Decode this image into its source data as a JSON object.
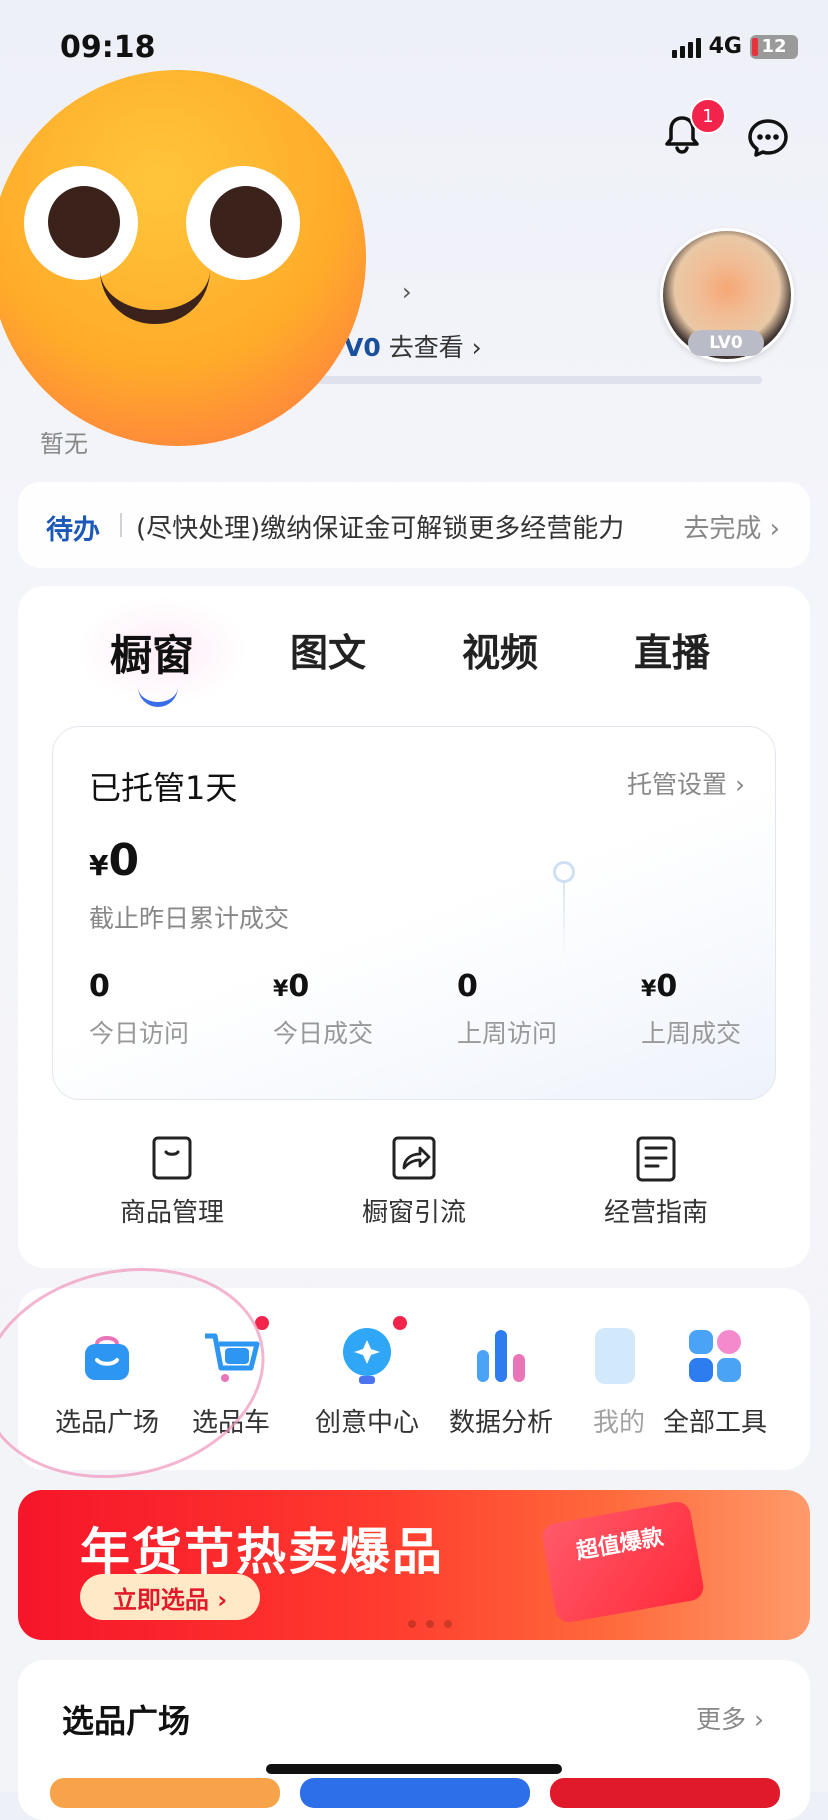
{
  "status_bar": {
    "time": "09:18",
    "network": "4G",
    "battery": "12"
  },
  "header": {
    "notification_count": "1"
  },
  "profile": {
    "level_prefix": "V0",
    "level_link": "去查看 ›",
    "avatar_level": "LV0",
    "desc_partial": "暂无"
  },
  "todo": {
    "tag": "待办",
    "text": "(尽快处理)缴纳保证金可解锁更多经营能力",
    "action": "去完成 ›"
  },
  "tabs": [
    "橱窗",
    "图文",
    "视频",
    "直播"
  ],
  "stats": {
    "title": "已托管1天",
    "settings_link": "托管设置 ›",
    "currency": "¥",
    "total_value": "0",
    "total_label": "截止昨日累计成交",
    "metrics": [
      {
        "value": "0",
        "currency": "",
        "label": "今日访问"
      },
      {
        "value": "0",
        "currency": "¥",
        "label": "今日成交"
      },
      {
        "value": "0",
        "currency": "",
        "label": "上周访问"
      },
      {
        "value": "0",
        "currency": "¥",
        "label": "上周成交"
      }
    ]
  },
  "quick_tools": [
    "商品管理",
    "橱窗引流",
    "经营指南"
  ],
  "tools": [
    "选品广场",
    "选品车",
    "创意中心",
    "数据分析",
    "我的",
    "全部工具"
  ],
  "banner": {
    "title": "年货节热卖爆品",
    "button": "立即选品 ›",
    "tag": "超值爆款"
  },
  "section": {
    "title": "选品广场",
    "more": "更多 ›"
  },
  "colors": {
    "accent_blue": "#1c58b8",
    "badge_red": "#f2244b",
    "banner_red": "#f6152a"
  }
}
